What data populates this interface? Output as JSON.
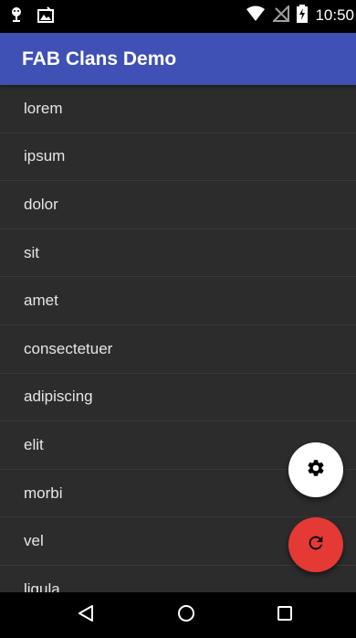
{
  "status_bar": {
    "time": "10:50",
    "icons": [
      "android-debug-icon",
      "photo-notification-icon",
      "wifi-icon",
      "no-signal-icon",
      "battery-charging-icon"
    ]
  },
  "app_bar": {
    "title": "FAB Clans Demo",
    "color": "#3f51b5"
  },
  "list": {
    "items": [
      "lorem",
      "ipsum",
      "dolor",
      "sit",
      "amet",
      "consectetuer",
      "adipiscing",
      "elit",
      "morbi",
      "vel",
      "ligula"
    ]
  },
  "fabs": {
    "settings": {
      "icon": "gear-icon",
      "color": "#ffffff"
    },
    "refresh": {
      "icon": "refresh-icon",
      "color": "#e53935"
    }
  },
  "nav_bar": {
    "buttons": [
      "back-icon",
      "home-icon",
      "recents-icon"
    ]
  }
}
